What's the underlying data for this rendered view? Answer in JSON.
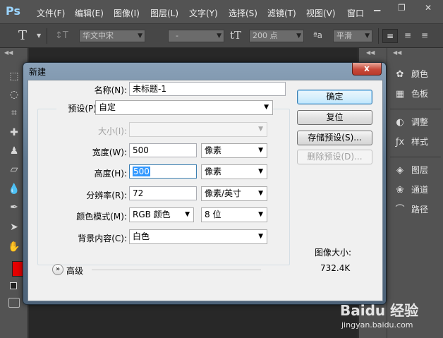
{
  "app": {
    "logo": "Ps",
    "menu": [
      "文件(F)",
      "编辑(E)",
      "图像(I)",
      "图层(L)",
      "文字(Y)",
      "选择(S)",
      "滤镜(T)",
      "视图(V)",
      "窗口"
    ],
    "window_controls": {
      "minimize": "▁",
      "restore": "❐",
      "close": "✕"
    }
  },
  "options_bar": {
    "font_family": "华文中宋",
    "font_style": "-",
    "font_size": "200 点",
    "anti_alias": "平滑"
  },
  "right_panels": [
    {
      "icon": "palette-icon",
      "label": "颜色"
    },
    {
      "icon": "swatches-icon",
      "label": "色板"
    },
    {
      "icon": "adjustments-icon",
      "label": "调整"
    },
    {
      "icon": "styles-icon",
      "label": "样式"
    },
    {
      "icon": "layers-icon",
      "label": "图层"
    },
    {
      "icon": "channels-icon",
      "label": "通道"
    },
    {
      "icon": "paths-icon",
      "label": "路径"
    }
  ],
  "dialog": {
    "title": "新建",
    "close": "x",
    "name_label": "名称(N):",
    "name_value": "未标题-1",
    "preset_label": "预设(P):",
    "preset_value": "自定",
    "size_label": "大小(I):",
    "size_value": "",
    "width_label": "宽度(W):",
    "width_value": "500",
    "width_unit": "像素",
    "height_label": "高度(H):",
    "height_value": "500",
    "height_unit": "像素",
    "resolution_label": "分辨率(R):",
    "resolution_value": "72",
    "resolution_unit": "像素/英寸",
    "color_mode_label": "颜色模式(M):",
    "color_mode_value": "RGB 颜色",
    "bit_depth_value": "8 位",
    "background_label": "背景内容(C):",
    "background_value": "白色",
    "advanced_label": "高级",
    "image_size_label": "图像大小:",
    "image_size_value": "732.4K",
    "buttons": {
      "ok": "确定",
      "reset": "复位",
      "save_preset": "存储预设(S)...",
      "delete_preset": "删除预设(D)..."
    }
  },
  "watermark": {
    "brand": "Baidu 经验",
    "url": "jingyan.baidu.com"
  },
  "colors": {
    "foreground": "#e60000",
    "background": "#ffffff",
    "selection": "#3399ff"
  }
}
